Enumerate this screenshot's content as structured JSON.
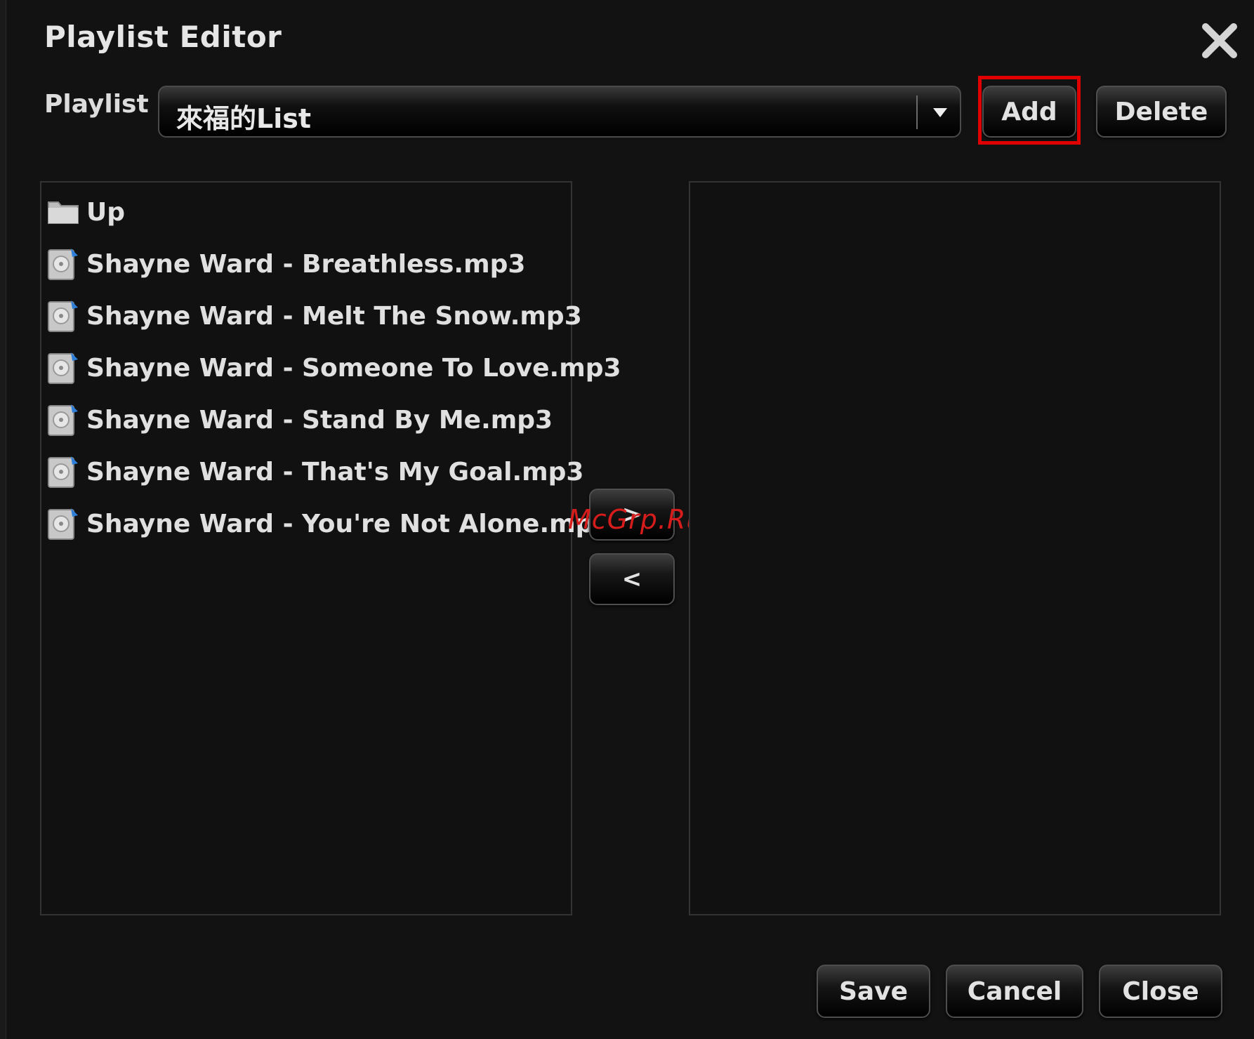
{
  "dialog": {
    "title": "Playlist Editor"
  },
  "playlist": {
    "label": "Playlist",
    "selected": "來福的List"
  },
  "buttons": {
    "add": "Add",
    "delete": "Delete",
    "move_right": ">",
    "move_left": "<",
    "save": "Save",
    "cancel": "Cancel",
    "close": "Close"
  },
  "file_list": {
    "up_label": "Up",
    "items": [
      "Shayne Ward - Breathless.mp3",
      "Shayne Ward - Melt The Snow.mp3",
      "Shayne Ward - Someone To Love.mp3",
      "Shayne Ward - Stand By Me.mp3",
      "Shayne Ward - That's My Goal.mp3",
      "Shayne Ward - You're Not Alone.mp3"
    ]
  },
  "watermark": "McGrp.Ru",
  "colors": {
    "highlight": "#e00000",
    "watermark": "#d71c1c",
    "background": "#121212"
  }
}
